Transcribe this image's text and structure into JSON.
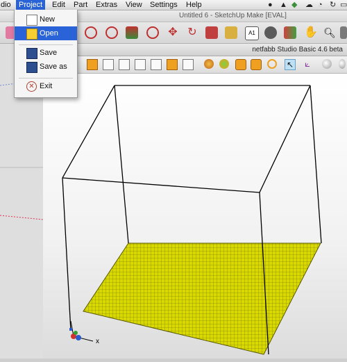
{
  "menubar": {
    "app_fragment": "dio",
    "items": [
      "Project",
      "Edit",
      "Part",
      "Extras",
      "View",
      "Settings",
      "Help"
    ]
  },
  "sketchup": {
    "title": "Untitled 6 - SketchUp Make [EVAL]"
  },
  "netfabb": {
    "title": "netfabb Studio Basic 4.6 beta",
    "axis_label": "x"
  },
  "project_menu": {
    "items": [
      {
        "label": "New",
        "icon": "new-file-icon"
      },
      {
        "label": "Open",
        "icon": "open-folder-icon",
        "highlighted": true
      },
      {
        "label": "Save",
        "icon": "floppy-disk-icon"
      },
      {
        "label": "Save as",
        "icon": "save-as-icon"
      },
      {
        "label": "Exit",
        "icon": "exit-circle-icon"
      }
    ]
  },
  "colors": {
    "menu_highlight": "#2a63d8",
    "platform_fill": "#d9d900",
    "platform_grid": "#6f6f00"
  }
}
